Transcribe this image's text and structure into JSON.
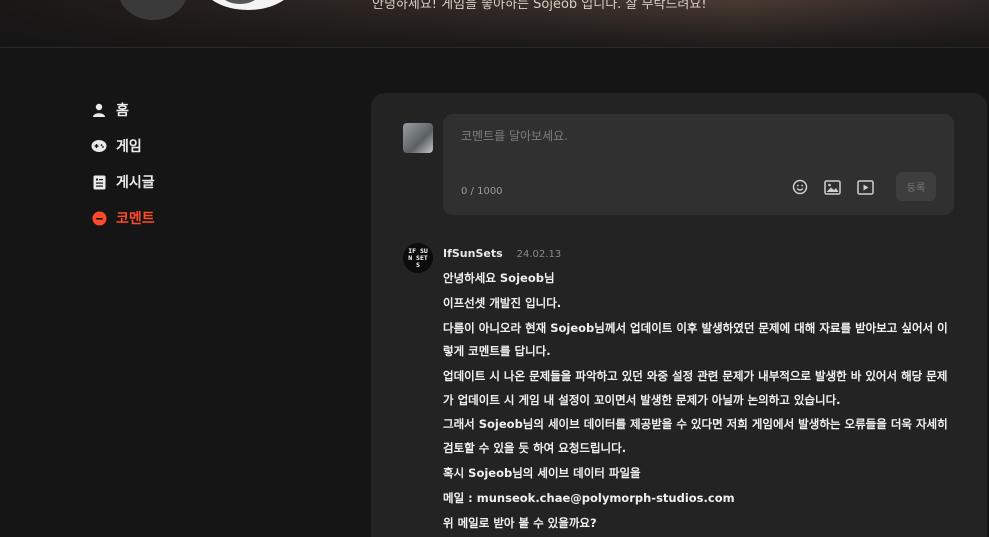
{
  "banner": {
    "bio": "안녕하세요! 게임을 좋아하는 Sojeob 입니다. 잘 부탁드려요!"
  },
  "sidebar": {
    "items": [
      {
        "label": "홈",
        "icon": "user-icon",
        "active": false
      },
      {
        "label": "게임",
        "icon": "gamepad-icon",
        "active": false
      },
      {
        "label": "게시글",
        "icon": "document-icon",
        "active": false
      },
      {
        "label": "코멘트",
        "icon": "comment-icon",
        "active": true
      }
    ]
  },
  "editor": {
    "placeholder": "코멘트를 달아보세요.",
    "counter": "0 / 1000",
    "submit_label": "등록",
    "tools": [
      "emoji-icon",
      "image-icon",
      "video-icon"
    ]
  },
  "comment": {
    "avatar_text": "IF SUN SETS",
    "author": "IfSunSets",
    "date": "24.02.13",
    "paragraphs": [
      "안녕하세요 Sojeob님",
      "이프선셋 개발진 입니다.",
      "다름이 아니오라 현재 Sojeob님께서 업데이트 이후 발생하였던 문제에 대해 자료를 받아보고 싶어서 이렇게 코멘트를 답니다.",
      "업데이트 시 나온 문제들을 파악하고 있던 와중 설정 관련 문제가 내부적으로 발생한 바 있어서 해당 문제가 업데이트 시 게임 내 설정이 꼬이면서 발생한 문제가 아닐까 논의하고 있습니다.",
      "그래서 Sojeob님의 세이브 데이터를 제공받을 수 있다면 저희 게임에서 발생하는 오류들을 더욱 자세히 검토할 수 있을 듯 하여 요청드립니다.",
      "혹시 Sojeob님의 세이브 데이터 파일을",
      "메일 : munseok.chae@polymorph-studios.com",
      "위 메일로 받아 볼 수 있을까요?"
    ]
  },
  "colors": {
    "accent": "#ff4b2b",
    "background": "#151515",
    "panel": "#232323"
  }
}
